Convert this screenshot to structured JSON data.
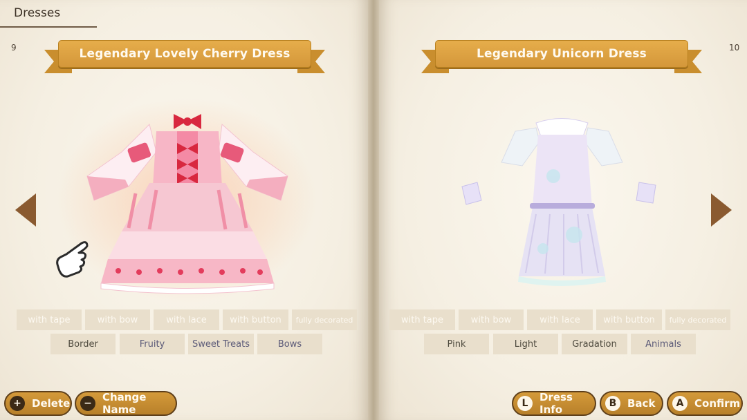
{
  "section": "Dresses",
  "left_page": {
    "page_number": "9",
    "title": "Legendary Lovely Cherry Dress",
    "tags_row1": [
      {
        "label": "with tape",
        "active": false
      },
      {
        "label": "with bow",
        "active": false
      },
      {
        "label": "with lace",
        "active": false
      },
      {
        "label": "with button",
        "active": false
      },
      {
        "label": "fully decorated",
        "active": false
      }
    ],
    "tags_row2": [
      {
        "label": "Border",
        "active": false
      },
      {
        "label": "Fruity",
        "active": true
      },
      {
        "label": "Sweet Treats",
        "active": true
      },
      {
        "label": "Bows",
        "active": true
      }
    ]
  },
  "right_page": {
    "page_number": "10",
    "title": "Legendary Unicorn Dress",
    "tags_row1": [
      {
        "label": "with tape",
        "active": false
      },
      {
        "label": "with bow",
        "active": false
      },
      {
        "label": "with lace",
        "active": false
      },
      {
        "label": "with button",
        "active": false
      },
      {
        "label": "fully decorated",
        "active": false
      }
    ],
    "tags_row2": [
      {
        "label": "Pink",
        "active": false
      },
      {
        "label": "Light",
        "active": false
      },
      {
        "label": "Gradation",
        "active": false
      },
      {
        "label": "Animals",
        "active": true
      }
    ]
  },
  "buttons": {
    "delete": {
      "key": "+",
      "label": "Delete"
    },
    "change_name": {
      "key": "−",
      "label": "Change Name"
    },
    "dress_info": {
      "key": "L",
      "label": "Dress Info"
    },
    "back": {
      "key": "B",
      "label": "Back"
    },
    "confirm": {
      "key": "A",
      "label": "Confirm"
    }
  },
  "icons": {
    "prev": "left-arrow-icon",
    "next": "right-arrow-icon",
    "pointer": "pointing-hand-icon"
  }
}
